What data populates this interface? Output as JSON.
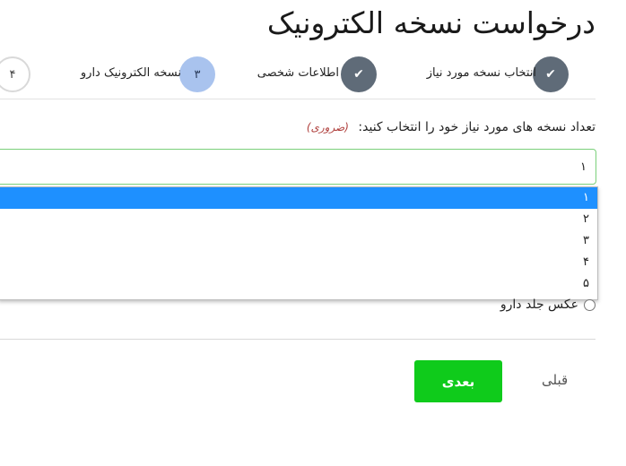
{
  "page": {
    "title": "درخواست نسخه الکترونیک"
  },
  "steps": [
    {
      "label": "انتخاب نسخه مورد نیاز",
      "state": "done",
      "marker": "✔"
    },
    {
      "label": "اطلاعات شخصی",
      "state": "done",
      "marker": "✔"
    },
    {
      "label": "نسخه الکترونیک دارو",
      "state": "active",
      "marker": "۳"
    },
    {
      "label": "",
      "state": "todo",
      "marker": "۴"
    }
  ],
  "form": {
    "question": "تعداد نسخه های مورد نیاز خود را انتخاب کنید:",
    "required_note": "(ضروری)",
    "select_value": "۱",
    "options": [
      "۱",
      "۲",
      "۳",
      "۴",
      "۵"
    ],
    "selected_option": "۱",
    "radio_label": "عکس جلد دارو"
  },
  "buttons": {
    "next": "بعدی",
    "prev": "قبلی"
  },
  "colors": {
    "accent_green": "#0fcb1b",
    "select_highlight": "#1e90ff",
    "step_done": "#5f6b78",
    "step_active": "#a9c3ee"
  }
}
